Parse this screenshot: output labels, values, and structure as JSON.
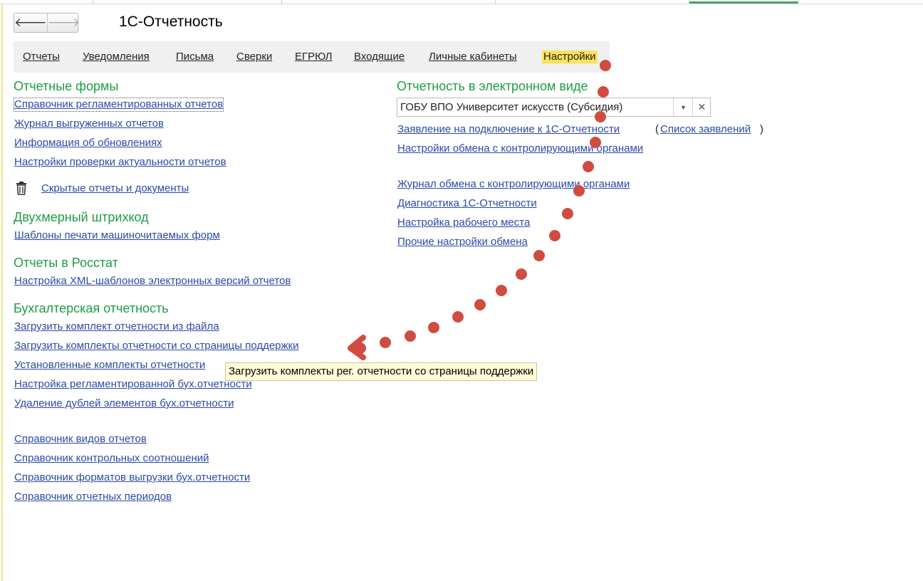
{
  "app": {
    "title": "1С-Отчетность"
  },
  "tabs": [
    {
      "label": "Отчеты"
    },
    {
      "label": "Уведомления"
    },
    {
      "label": "Письма"
    },
    {
      "label": "Сверки"
    },
    {
      "label": "ЕГРЮЛ"
    },
    {
      "label": "Входящие"
    },
    {
      "label": "Личные кабинеты"
    },
    {
      "label": "Настройки",
      "active": true
    }
  ],
  "left": {
    "report_forms": {
      "title": "Отчетные формы",
      "links": [
        "Справочник регламентированных отчетов",
        "Журнал выгруженных отчетов",
        "Информация об обновлениях",
        "Настройки проверки актуальности отчетов"
      ],
      "hidden_link": "Скрытые отчеты и документы"
    },
    "barcode": {
      "title": "Двухмерный штрихкод",
      "links": [
        "Шаблоны печати машиночитаемых форм"
      ]
    },
    "rosstat": {
      "title": "Отчеты в Росстат",
      "links": [
        "Настройка XML-шаблонов электронных версий отчетов"
      ]
    },
    "accounting": {
      "title": "Бухгалтерская отчетность",
      "links": [
        "Загрузить комплект отчетности из файла",
        "Загрузить комплекты отчетности со страницы поддержки",
        "Установленные комплекты отчетности",
        "Настройка регламентированной бух.отчетности",
        "Удаление дублей элементов бух.отчетности"
      ]
    },
    "directories": [
      "Справочник видов отчетов",
      "Справочник контрольных соотношений",
      "Справочник форматов выгрузки бух.отчетности",
      "Справочник отчетных периодов"
    ]
  },
  "right": {
    "title": "Отчетность в электронном виде",
    "organization": "ГОБУ ВПО Университет искусств (Субсидия)",
    "application_link": "Заявление на подключение к 1С-Отчетности",
    "applications_open": "(",
    "applications_list": "Список заявлений",
    "applications_close": ")",
    "exchange_settings": "Настройки обмена с контролирующими органами",
    "links": [
      "Журнал обмена с контролирующими органами",
      "Диагностика 1С-Отчетности",
      "Настройка рабочего места",
      "Прочие настройки обмена"
    ]
  },
  "tooltip": "Загрузить комплекты рег. отчетности со страницы поддержки",
  "icons": {
    "back": "arrow-left-icon",
    "forward": "arrow-right-icon",
    "trash": "trash-icon",
    "dropdown": "dropdown-icon",
    "clear": "clear-icon"
  },
  "colors": {
    "section": "#1f9c45",
    "link": "#2b4aa6",
    "active_tab": "#fbe358",
    "annotation_dots": "#d14c40",
    "tooltip_bg": "#fffbd6"
  }
}
